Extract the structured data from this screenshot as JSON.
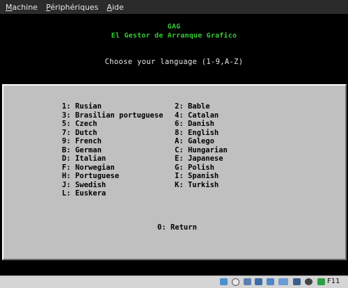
{
  "menubar": {
    "machine": {
      "mnemonic": "M",
      "rest": "achine"
    },
    "devices": {
      "mnemonic": "P",
      "rest": "ériphériques"
    },
    "help": {
      "mnemonic": "A",
      "rest": "ide"
    }
  },
  "screen": {
    "title": "GAG",
    "subtitle": "El Gestor de Arranque Grafico",
    "prompt": "Choose your language (1-9,A-Z)",
    "left_column": [
      "1: Rusian",
      "3: Brasilian portuguese",
      "5: Czech",
      "7: Dutch",
      "9: French",
      "B: German",
      "D: Italian",
      "F: Norwegian",
      "H: Portuguese",
      "J: Swedish",
      "L: Euskera"
    ],
    "right_column": [
      "2: Bable",
      "4: Catalan",
      "6: Danish",
      "8: English",
      "A: Galego",
      "C: Hungarian",
      "E: Japanese",
      "G: Polish",
      "I: Spanish",
      "K: Turkish"
    ],
    "return_label": "0: Return"
  },
  "statusbar": {
    "host_key": "F11",
    "icons": [
      "hard-disk-icon",
      "optical-drive-icon",
      "usb-icon",
      "shared-folders-icon",
      "display-icon",
      "network-icon",
      "recording-icon",
      "mouse-integration-icon",
      "keyboard-capture-icon"
    ]
  },
  "colors": {
    "title_green": "#33cc33",
    "panel_gray": "#c0c0c0",
    "screen_black": "#000000"
  }
}
